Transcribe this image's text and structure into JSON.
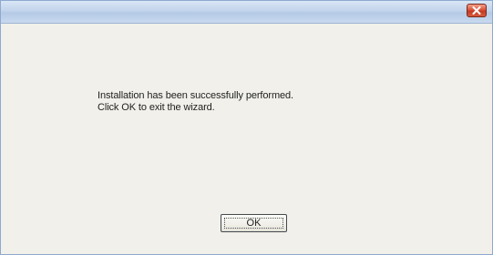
{
  "dialog": {
    "close_icon": "close-x-icon",
    "message_line1": "Installation has been successfully performed.",
    "message_line2": "Click OK to exit the wizard.",
    "ok_label": "OK"
  },
  "colors": {
    "titlebar": "#c2d4ec",
    "close_button": "#d9533a",
    "background": "#f1f0ea"
  }
}
